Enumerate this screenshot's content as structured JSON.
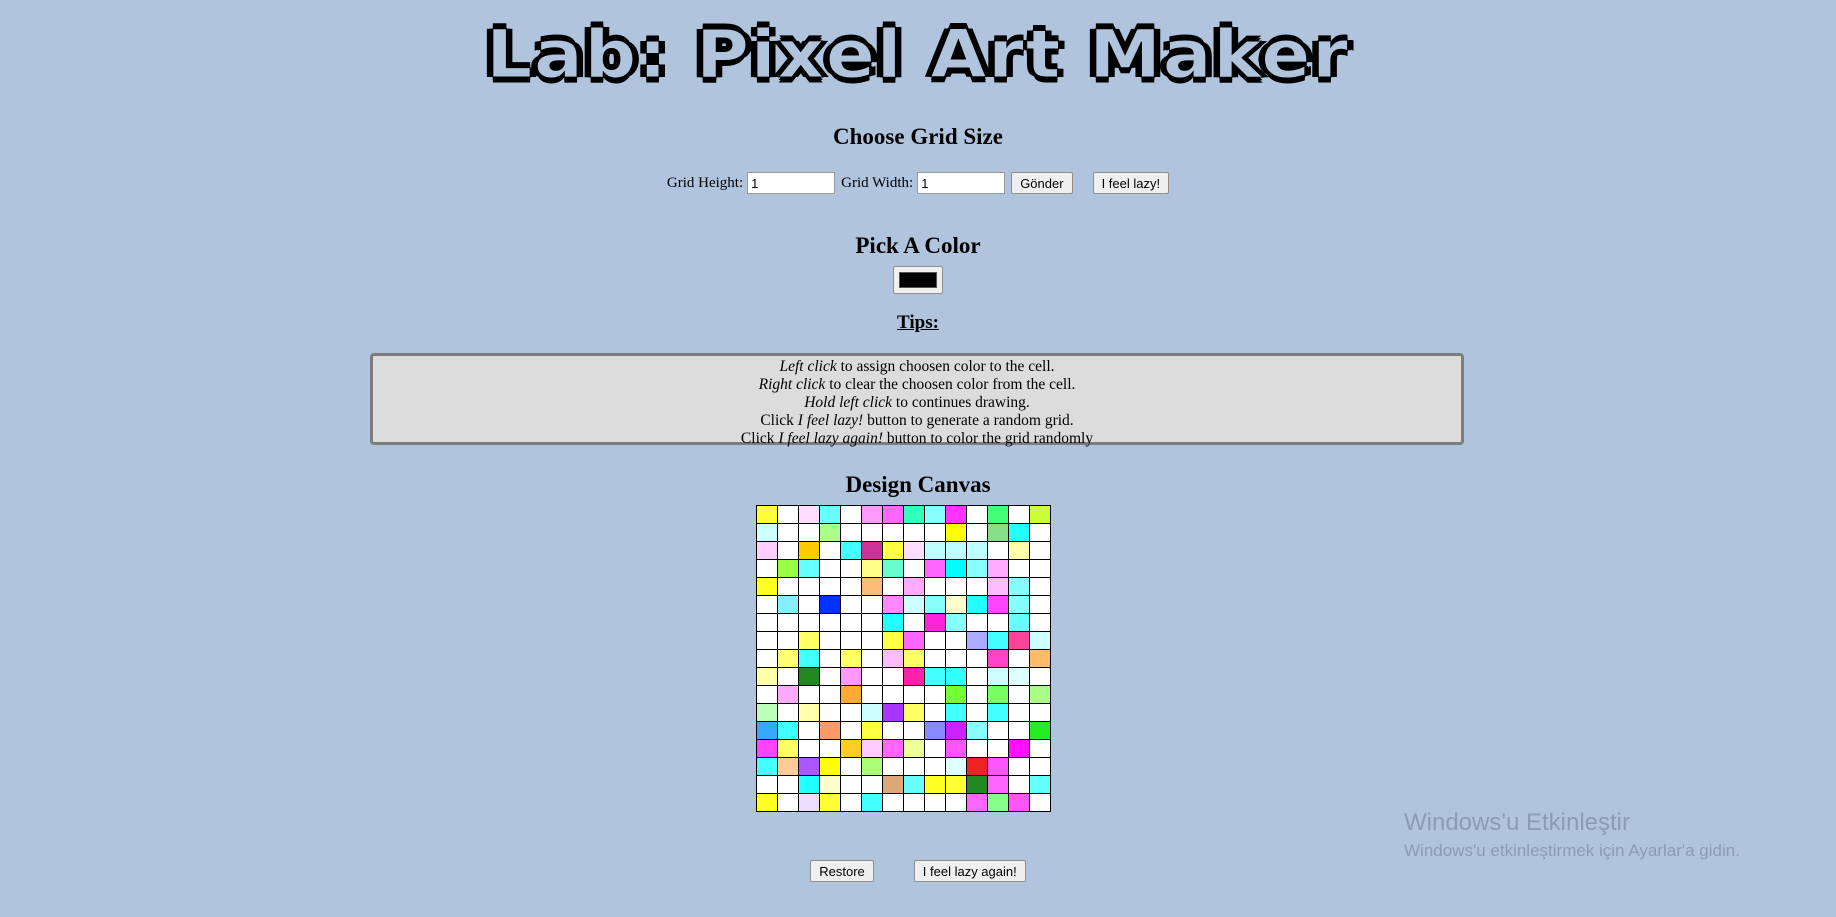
{
  "title": "Lab: Pixel Art Maker",
  "grid_size": {
    "heading": "Choose Grid Size",
    "height_label": "Grid Height:",
    "height_value": "1",
    "width_label": "Grid Width:",
    "width_value": "1",
    "submit_label": "Gönder",
    "lazy_label": "I feel lazy!"
  },
  "color": {
    "heading": "Pick A Color",
    "value": "#000000"
  },
  "tips": {
    "heading": "Tips:",
    "lines": [
      {
        "em": "Left click",
        "text": " to assign choosen color to the cell."
      },
      {
        "em": "Right click",
        "text": " to clear the choosen color from the cell."
      },
      {
        "em": "Hold left click",
        "text": " to continues drawing."
      },
      {
        "pre": "Click ",
        "em": "I feel lazy!",
        "text": " button to generate a random grid."
      },
      {
        "pre": "Click ",
        "em": "I feel lazy again!",
        "text": " button to color the grid randomly"
      }
    ]
  },
  "canvas": {
    "heading": "Design Canvas",
    "colors": [
      [
        "#ffff33",
        "#ffffff",
        "#ffddff",
        "#66ffff",
        "#ffffff",
        "#ff99ff",
        "#ff66ff",
        "#33ffbb",
        "#88ffff",
        "#ff33ff",
        "#ffffff",
        "#44ff77",
        "#ffffff",
        "#ccff33"
      ],
      [
        "#ccffff",
        "#ffffff",
        "#ffffff",
        "#aaff88",
        "#ffffff",
        "#ffffff",
        "#ffffff",
        "#ffffff",
        "#ffffff",
        "#ffff00",
        "#ffffff",
        "#88dd88",
        "#22ffff",
        "#ffffff"
      ],
      [
        "#ffccff",
        "#ffffff",
        "#ffcc00",
        "#ffffff",
        "#44ffff",
        "#cc3399",
        "#ffff44",
        "#ffddff",
        "#bbffff",
        "#bbffff",
        "#bbffff",
        "#ffffff",
        "#ffffaa",
        "#ffffff"
      ],
      [
        "#ffffff",
        "#99ff44",
        "#66ffff",
        "#ffffff",
        "#ffffff",
        "#ffff88",
        "#66ffcc",
        "#ffffff",
        "#ff66ff",
        "#00ffff",
        "#88ffff",
        "#ffaaff",
        "#ffffff",
        "#ffffff"
      ],
      [
        "#ffff22",
        "#ffffff",
        "#ffffff",
        "#ffffff",
        "#ffffff",
        "#ffbb77",
        "#ffffff",
        "#ffaaff",
        "#ffffff",
        "#ffffff",
        "#ffffff",
        "#ffbbff",
        "#88ffff",
        "#ffffff"
      ],
      [
        "#ffffff",
        "#88eeff",
        "#ffffff",
        "#0033ff",
        "#ffffff",
        "#ffffff",
        "#ff88ff",
        "#ccffff",
        "#88ffff",
        "#ffffcc",
        "#22ffff",
        "#ff44ff",
        "#88ffff",
        "#ffffff"
      ],
      [
        "#ffffff",
        "#ffffff",
        "#ffffff",
        "#ffffff",
        "#ffffff",
        "#ffffff",
        "#22ffff",
        "#ffffff",
        "#ff22dd",
        "#88ffff",
        "#ffffff",
        "#ffffff",
        "#66ffff",
        "#ffffff"
      ],
      [
        "#ffffff",
        "#ffffff",
        "#ffff66",
        "#ffffff",
        "#ffffff",
        "#ffffff",
        "#ffff44",
        "#ff66ff",
        "#ffffff",
        "#ffffff",
        "#aaaaff",
        "#44ffff",
        "#ff4499",
        "#ccffff"
      ],
      [
        "#ffffff",
        "#ffff77",
        "#44ffff",
        "#ffffff",
        "#ffff66",
        "#ffffff",
        "#ffbbff",
        "#ffff66",
        "#ffffff",
        "#ffffff",
        "#ffffff",
        "#ff44cc",
        "#ffffff",
        "#ffbb66"
      ],
      [
        "#ffffaa",
        "#ffffff",
        "#228822",
        "#ffffff",
        "#ff99ff",
        "#ffffff",
        "#ffffff",
        "#ff22aa",
        "#44ffff",
        "#33ffff",
        "#ffffff",
        "#ccffff",
        "#ddffff",
        "#ffffff"
      ],
      [
        "#ffffff",
        "#ffaaff",
        "#ffffff",
        "#ffffff",
        "#ffaa33",
        "#ffffff",
        "#ffffff",
        "#ffffff",
        "#ffffff",
        "#77ff33",
        "#ffffff",
        "#77ff66",
        "#ffffff",
        "#aaff88"
      ],
      [
        "#bbffbb",
        "#ffffff",
        "#ffffaa",
        "#ffffff",
        "#ffffff",
        "#ccffff",
        "#aa33ff",
        "#ffff66",
        "#ffffff",
        "#44ffff",
        "#ffffff",
        "#44ffff",
        "#ffffff",
        "#ffffff"
      ],
      [
        "#33aaff",
        "#44ffff",
        "#ffffff",
        "#ff9966",
        "#ffffff",
        "#ffff44",
        "#ffffff",
        "#ffffff",
        "#8888ff",
        "#cc22ff",
        "#88ffff",
        "#ffffff",
        "#ffffff",
        "#22ee22"
      ],
      [
        "#ff44ff",
        "#ffff66",
        "#ffffff",
        "#ffffff",
        "#ffcc22",
        "#ffccff",
        "#ff66ff",
        "#eeff99",
        "#ffffff",
        "#ff55ff",
        "#ffffff",
        "#ffffff",
        "#ff11ff",
        "#ffffff"
      ],
      [
        "#44ffff",
        "#ffcc99",
        "#aa55ff",
        "#ffff00",
        "#ffffff",
        "#aaff77",
        "#ffffff",
        "#ffffff",
        "#ffffff",
        "#ddffff",
        "#ee2222",
        "#ff55ff",
        "#ffffff",
        "#ffffff"
      ],
      [
        "#ffffff",
        "#ffffff",
        "#22ffff",
        "#ffffcc",
        "#ffffff",
        "#ffffff",
        "#ddaa77",
        "#66ffff",
        "#ffff22",
        "#ffff33",
        "#228822",
        "#ff66ff",
        "#ffffff",
        "#66ffff"
      ],
      [
        "#ffff22",
        "#ffffff",
        "#eeddff",
        "#ffff33",
        "#ffffff",
        "#44ffff",
        "#ffffff",
        "#ffffff",
        "#ffffff",
        "#ffffff",
        "#ff66ff",
        "#88ff88",
        "#ff55ff",
        "#ffffff"
      ]
    ],
    "restore_label": "Restore",
    "lazy_again_label": "I feel lazy again!"
  },
  "watermark": {
    "line1": "Windows'u Etkinleştir",
    "line2": "Windows'u etkinleştirmek için Ayarlar'a gidin."
  }
}
